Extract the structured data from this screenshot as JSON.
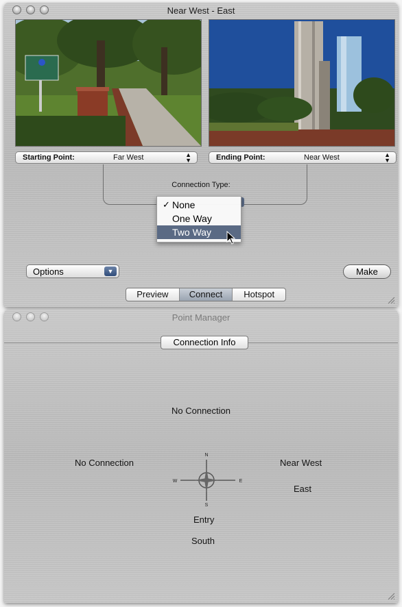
{
  "colors": {
    "menu_highlight": "#5a6a84",
    "popup_button": "#3a5888"
  },
  "top_window": {
    "title": "Near West - East",
    "starting_point": {
      "label": "Starting Point:",
      "value": "Far West"
    },
    "ending_point": {
      "label": "Ending Point:",
      "value": "Near West"
    },
    "connection_type_label": "Connection Type:",
    "connection_menu": {
      "items": [
        {
          "label": "None",
          "checked": true
        },
        {
          "label": "One Way",
          "checked": false
        },
        {
          "label": "Two Way",
          "checked": false,
          "highlighted": true
        }
      ],
      "check_glyph": "✓"
    },
    "options_popup": "Options",
    "make_button": "Make",
    "tabs": [
      "Preview",
      "Connect",
      "Hotspot"
    ],
    "active_tab": "Connect"
  },
  "bottom_window": {
    "title": "Point Manager",
    "connection_info_button": "Connection Info",
    "top_text": "No Connection",
    "left_text": "No Connection",
    "right_text_1": "Near West",
    "right_text_2": "East",
    "bottom_text_1": "Entry",
    "bottom_text_2": "South",
    "compass": {
      "n": "N",
      "s": "S",
      "e": "E",
      "w": "W"
    }
  }
}
